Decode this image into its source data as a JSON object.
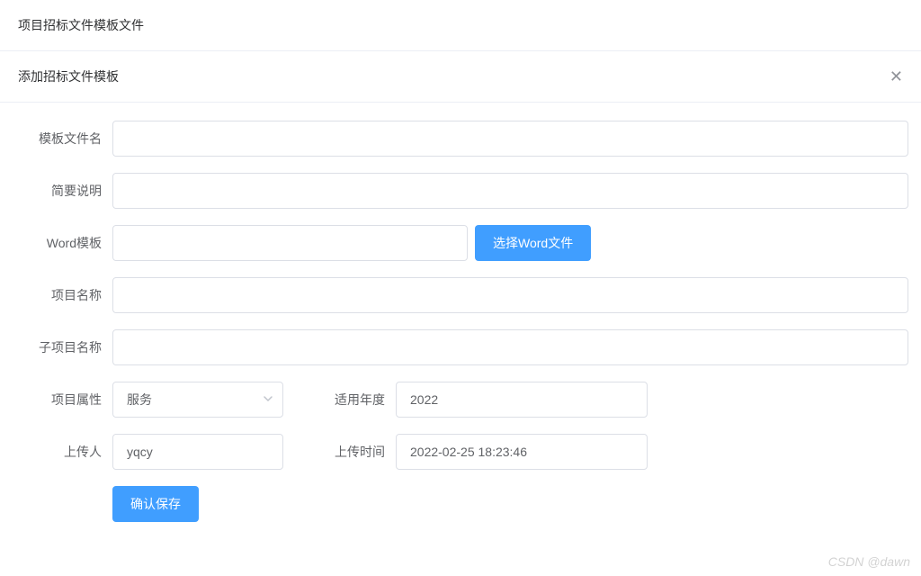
{
  "page_title": "项目招标文件模板文件",
  "modal_title": "添加招标文件模板",
  "form": {
    "template_filename": {
      "label": "模板文件名",
      "value": ""
    },
    "brief_desc": {
      "label": "简要说明",
      "value": ""
    },
    "word_template": {
      "label": "Word模板",
      "value": "",
      "pick_button": "选择Word文件"
    },
    "project_name": {
      "label": "项目名称",
      "value": ""
    },
    "sub_project_name": {
      "label": "子项目名称",
      "value": ""
    },
    "project_attr": {
      "label": "项目属性",
      "value": "服务"
    },
    "year": {
      "label": "适用年度",
      "value": "2022"
    },
    "uploader": {
      "label": "上传人",
      "value": "yqcy"
    },
    "upload_time": {
      "label": "上传时间",
      "value": "2022-02-25 18:23:46"
    },
    "submit_label": "确认保存"
  },
  "watermark": "CSDN @dawn"
}
